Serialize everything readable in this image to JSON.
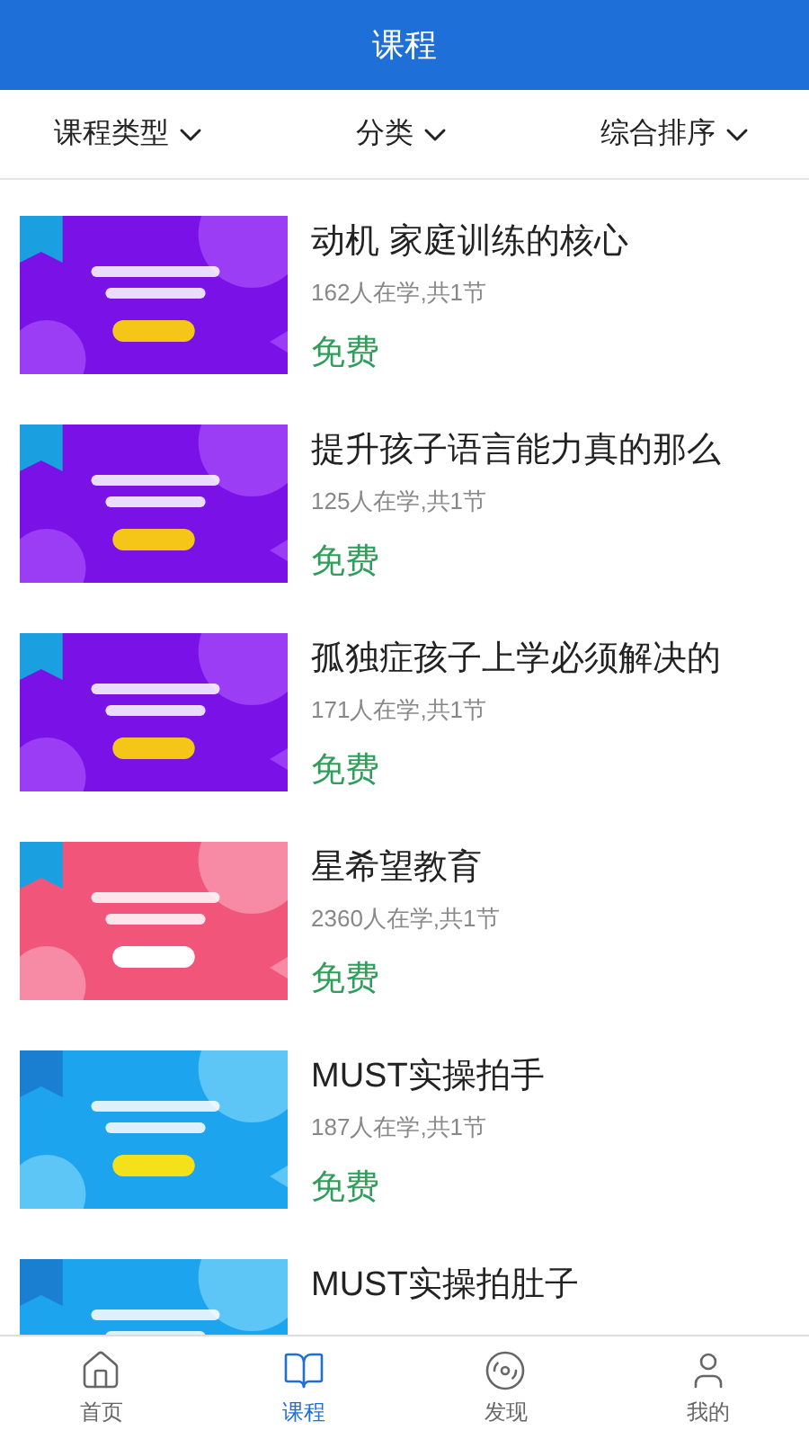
{
  "header": {
    "title": "课程"
  },
  "filters": [
    {
      "label": "课程类型"
    },
    {
      "label": "分类"
    },
    {
      "label": "综合排序"
    }
  ],
  "courses": [
    {
      "title": "动机 家庭训练的核心",
      "meta": "162人在学,共1节",
      "price": "免费"
    },
    {
      "title": "提升孩子语言能力真的那么",
      "meta": "125人在学,共1节",
      "price": "免费"
    },
    {
      "title": "孤独症孩子上学必须解决的",
      "meta": "171人在学,共1节",
      "price": "免费"
    },
    {
      "title": "星希望教育",
      "meta": "2360人在学,共1节",
      "price": "免费"
    },
    {
      "title": "MUST实操拍手",
      "meta": "187人在学,共1节",
      "price": "免费"
    },
    {
      "title": "MUST实操拍肚子"
    }
  ],
  "tabbar": [
    {
      "label": "首页",
      "selected": false
    },
    {
      "label": "课程",
      "selected": true
    },
    {
      "label": "发现",
      "selected": false
    },
    {
      "label": "我的",
      "selected": false
    }
  ]
}
